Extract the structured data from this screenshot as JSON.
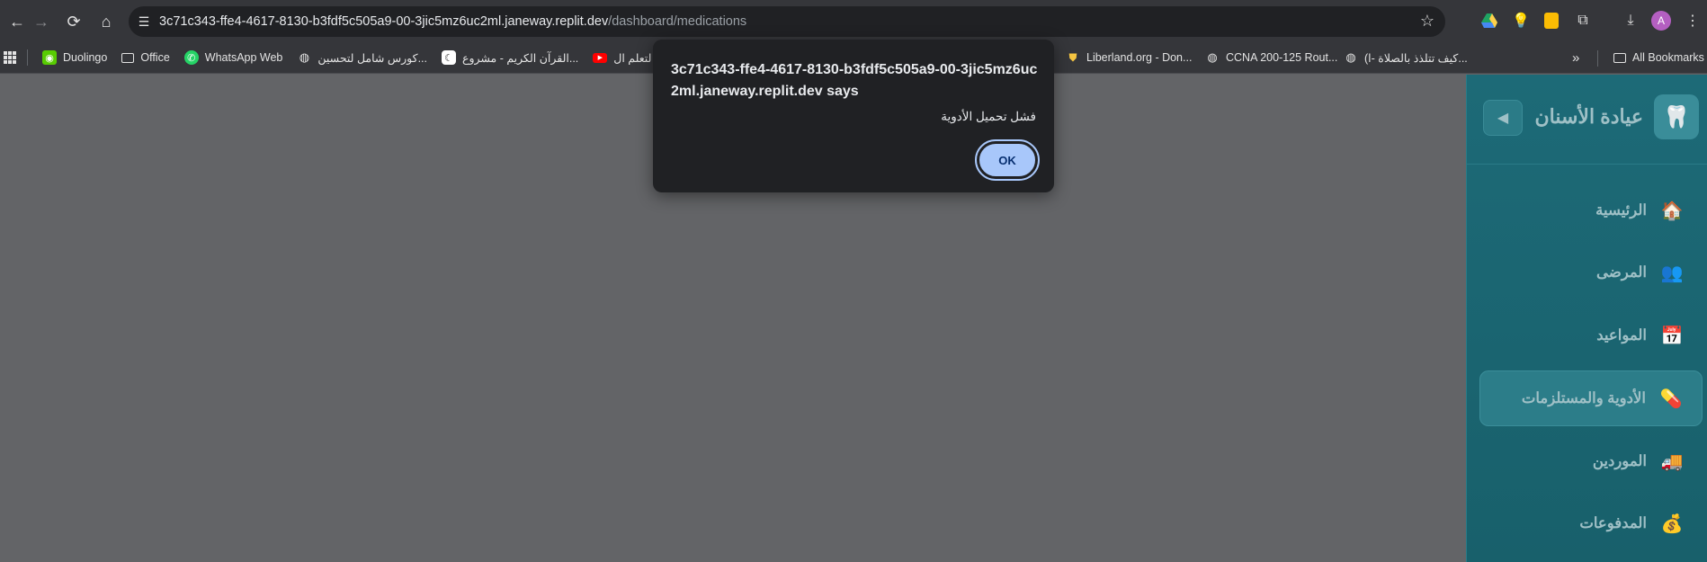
{
  "browser": {
    "url_host": "3c71c343-ffe4-4617-8130-b3fdf5c505a9-00-3jic5mz6uc2ml.janeway.replit.dev",
    "url_path": "/dashboard/medications",
    "avatar_letter": "A"
  },
  "bookmarks": [
    {
      "label": "Duolingo"
    },
    {
      "label": "Office"
    },
    {
      "label": "WhatsApp Web"
    },
    {
      "label": "كورس شامل لتحسين..."
    },
    {
      "label": "القرآن الكريم - مشروع..."
    },
    {
      "label": "ل لتعلم ال..."
    },
    {
      "label": "Liberland.org - Don..."
    },
    {
      "label": "CCNA 200-125 Rout..."
    },
    {
      "label": "(كيف تتلذذ بالصلاة -ا..."
    }
  ],
  "all_bookmarks": "All Bookmarks",
  "overflow": "»",
  "dialog": {
    "title": "3c71c343-ffe4-4617-8130-b3fdf5c505a9-00-3jic5mz6uc2ml.janeway.replit.dev says",
    "message": "فشل تحميل الأدوية",
    "ok_label": "OK"
  },
  "sidebar": {
    "brand": "عيادة الأسنان",
    "collapse": "◀",
    "items": [
      {
        "label": "الرئيسية",
        "icon": "🏠"
      },
      {
        "label": "المرضى",
        "icon": "👥"
      },
      {
        "label": "المواعيد",
        "icon": "📅"
      },
      {
        "label": "الأدوية والمستلزمات",
        "icon": "💊"
      },
      {
        "label": "الموردين",
        "icon": "🚚"
      },
      {
        "label": "المدفوعات",
        "icon": "💰"
      }
    ]
  }
}
